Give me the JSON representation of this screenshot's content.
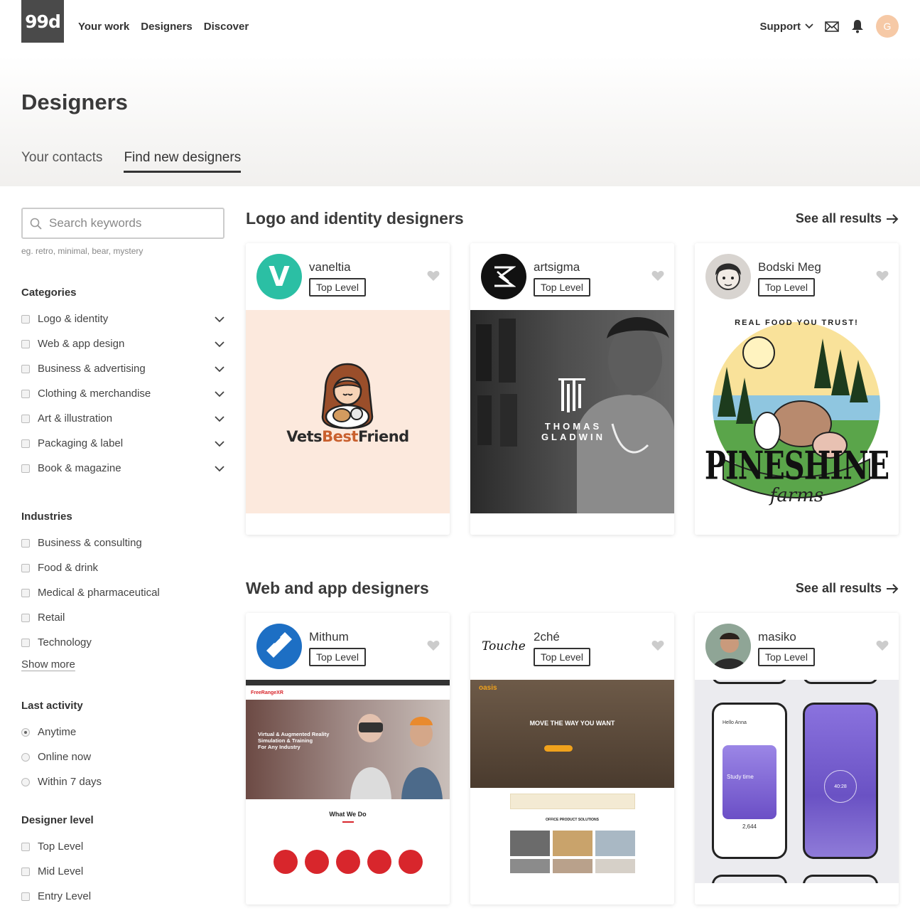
{
  "nav": {
    "logo": "99d",
    "links": [
      "Your work",
      "Designers",
      "Discover"
    ],
    "support": "Support",
    "avatar_initial": "G"
  },
  "header": {
    "title": "Designers",
    "tabs": [
      "Your contacts",
      "Find new designers"
    ]
  },
  "sidebar": {
    "search_placeholder": "Search keywords",
    "search_hint": "eg. retro, minimal, bear, mystery",
    "categories_title": "Categories",
    "categories": [
      "Logo & identity",
      "Web & app design",
      "Business & advertising",
      "Clothing & merchandise",
      "Art & illustration",
      "Packaging & label",
      "Book & magazine"
    ],
    "industries_title": "Industries",
    "industries": [
      "Business & consulting",
      "Food & drink",
      "Medical & pharmaceutical",
      "Retail",
      "Technology"
    ],
    "show_more": "Show more",
    "activity_title": "Last activity",
    "activity": [
      "Anytime",
      "Online now",
      "Within 7 days"
    ],
    "activity_selected": "Anytime",
    "level_title": "Designer level",
    "levels": [
      "Top Level",
      "Mid Level",
      "Entry Level"
    ]
  },
  "sections": [
    {
      "title": "Logo and identity designers",
      "see_all": "See all results",
      "cards": [
        {
          "name": "vaneltia",
          "badge": "Top Level",
          "avatar_letter": "V",
          "image_text": [
            "Vets",
            "Best",
            "Friend"
          ]
        },
        {
          "name": "artsigma",
          "badge": "Top Level",
          "image_text": [
            "THOMAS",
            "GLADWIN"
          ]
        },
        {
          "name": "Bodski Meg",
          "badge": "Top Level",
          "image_text": [
            "REAL FOOD YOU TRUST!",
            "PINESHINE",
            "farms"
          ]
        }
      ]
    },
    {
      "title": "Web and app designers",
      "see_all": "See all results",
      "cards": [
        {
          "name": "Mithum",
          "badge": "Top Level",
          "image_text": [
            "FreeRangeXR",
            "Virtual & Augmented Reality",
            "Simulation & Training",
            "For Any Industry",
            "What We Do"
          ]
        },
        {
          "name": "2ché",
          "badge": "Top Level",
          "avatar_text": "Touche",
          "image_text": [
            "oasis",
            "MOVE THE WAY YOU WANT",
            "OFFICE PRODUCT SOLUTIONS"
          ]
        },
        {
          "name": "masiko",
          "badge": "Top Level",
          "image_text": [
            "Hello Anna",
            "Study time",
            "2,644",
            "40:28"
          ]
        }
      ]
    }
  ],
  "colors": {
    "teal": "#2bbfa4",
    "blue": "#1d6fc4",
    "red": "#d8262c",
    "purple": "#7d5fd1"
  }
}
